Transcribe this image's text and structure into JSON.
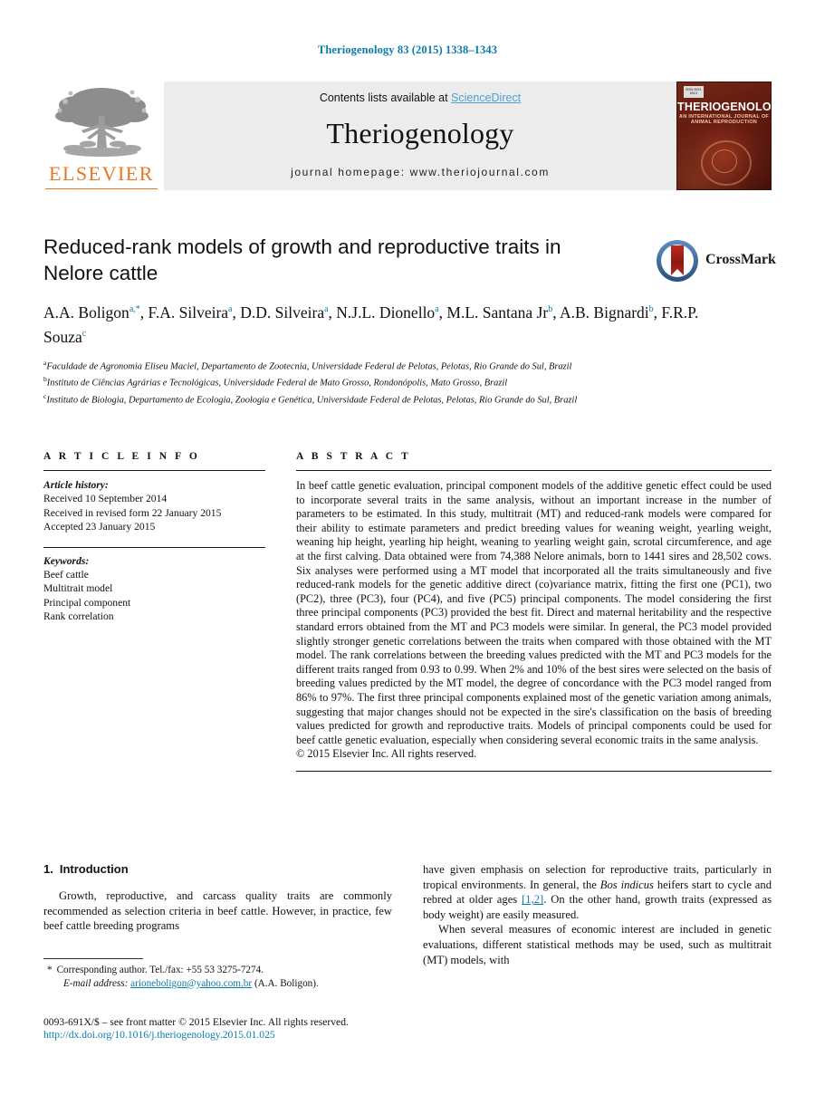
{
  "running_head": "Theriogenology 83 (2015) 1338–1343",
  "masthead": {
    "publisher_name": "ELSEVIER",
    "contents_prefix": "Contents lists available at ",
    "sciencedirect": "ScienceDirect",
    "journal_name": "Theriogenology",
    "homepage": "journal homepage: www.theriojournal.com",
    "cover": {
      "title": "THERIOGENOLOGY",
      "subtitle": "AN INTERNATIONAL JOURNAL OF ANIMAL REPRODUCTION",
      "badge": "ISSN 0093-691X"
    }
  },
  "article": {
    "title": "Reduced-rank models of growth and reproductive traits in Nelore cattle",
    "crossmark_label": "CrossMark",
    "authors_line1": "A.A. Boligon",
    "authors": [
      {
        "name": "A.A. Boligon",
        "sup": "a,*"
      },
      {
        "name": "F.A. Silveira",
        "sup": "a"
      },
      {
        "name": "D.D. Silveira",
        "sup": "a"
      },
      {
        "name": "N.J.L. Dionello",
        "sup": "a"
      },
      {
        "name": "M.L. Santana Jr",
        "sup": "b"
      },
      {
        "name": "A.B. Bignardi",
        "sup": "b"
      },
      {
        "name": "F.R.P. Souza",
        "sup": "c"
      }
    ],
    "affiliations": [
      {
        "sup": "a",
        "text": "Faculdade de Agronomia Eliseu Maciel, Departamento de Zootecnia, Universidade Federal de Pelotas, Pelotas, Rio Grande do Sul, Brazil"
      },
      {
        "sup": "b",
        "text": "Instituto de Ciências Agrárias e Tecnológicas, Universidade Federal de Mato Grosso, Rondonópolis, Mato Grosso, Brazil"
      },
      {
        "sup": "c",
        "text": "Instituto de Biologia, Departamento de Ecologia, Zoologia e Genética, Universidade Federal de Pelotas, Pelotas, Rio Grande do Sul, Brazil"
      }
    ]
  },
  "article_info": {
    "heading": "A R T I C L E  I N F O",
    "history_label": "Article history:",
    "history": [
      "Received 10 September 2014",
      "Received in revised form 22 January 2015",
      "Accepted 23 January 2015"
    ],
    "keywords_label": "Keywords:",
    "keywords": [
      "Beef cattle",
      "Multitrait model",
      "Principal component",
      "Rank correlation"
    ]
  },
  "abstract": {
    "heading": "A B S T R A C T",
    "text": "In beef cattle genetic evaluation, principal component models of the additive genetic effect could be used to incorporate several traits in the same analysis, without an important increase in the number of parameters to be estimated. In this study, multitrait (MT) and reduced-rank models were compared for their ability to estimate parameters and predict breeding values for weaning weight, yearling weight, weaning hip height, yearling hip height, weaning to yearling weight gain, scrotal circumference, and age at the first calving. Data obtained were from 74,388 Nelore animals, born to 1441 sires and 28,502 cows. Six analyses were performed using a MT model that incorporated all the traits simultaneously and five reduced-rank models for the genetic additive direct (co)variance matrix, fitting the first one (PC1), two (PC2), three (PC3), four (PC4), and five (PC5) principal components. The model considering the first three principal components (PC3) provided the best fit. Direct and maternal heritability and the respective standard errors obtained from the MT and PC3 models were similar. In general, the PC3 model provided slightly stronger genetic correlations between the traits when compared with those obtained with the MT model. The rank correlations between the breeding values predicted with the MT and PC3 models for the different traits ranged from 0.93 to 0.99. When 2% and 10% of the best sires were selected on the basis of breeding values predicted by the MT model, the degree of concordance with the PC3 model ranged from 86% to 97%. The first three principal components explained most of the genetic variation among animals, suggesting that major changes should not be expected in the sire's classification on the basis of breeding values predicted for growth and reproductive traits. Models of principal components could be used for beef cattle genetic evaluation, especially when considering several economic traits in the same analysis.",
    "copyright": "© 2015 Elsevier Inc. All rights reserved."
  },
  "introduction": {
    "number": "1.",
    "heading": "Introduction",
    "col1_p1": "Growth, reproductive, and carcass quality traits are commonly recommended as selection criteria in beef cattle. However, in practice, few beef cattle breeding programs",
    "col2_p1_a": "have given emphasis on selection for reproductive traits, particularly in tropical environments. In general, the ",
    "col2_p1_italic": "Bos indicus",
    "col2_p1_b": " heifers start to cycle and rebred at older ages ",
    "col2_p1_ref": "[1,2]",
    "col2_p1_c": ". On the other hand, growth traits (expressed as body weight) are easily measured.",
    "col2_p2_a": "When several measures of economic interest are included in genetic evaluations, different statistical methods may be used, such as multitrait (MT) models, with"
  },
  "footnote": {
    "star": "*",
    "corresponding": "Corresponding author. Tel./fax: +55 53 3275-7274.",
    "email_label": "E-mail address:",
    "email": "arioneboligon@yahoo.com.br",
    "email_owner": "(A.A. Boligon)."
  },
  "imprint": {
    "line": "0093-691X/$ – see front matter © 2015 Elsevier Inc. All rights reserved.",
    "doi": "http://dx.doi.org/10.1016/j.theriogenology.2015.01.025"
  },
  "colors": {
    "link": "#0b7bad",
    "sciencedirect": "#4ea0d6",
    "elsevier_orange": "#e87722",
    "band_gray": "#ececec"
  }
}
